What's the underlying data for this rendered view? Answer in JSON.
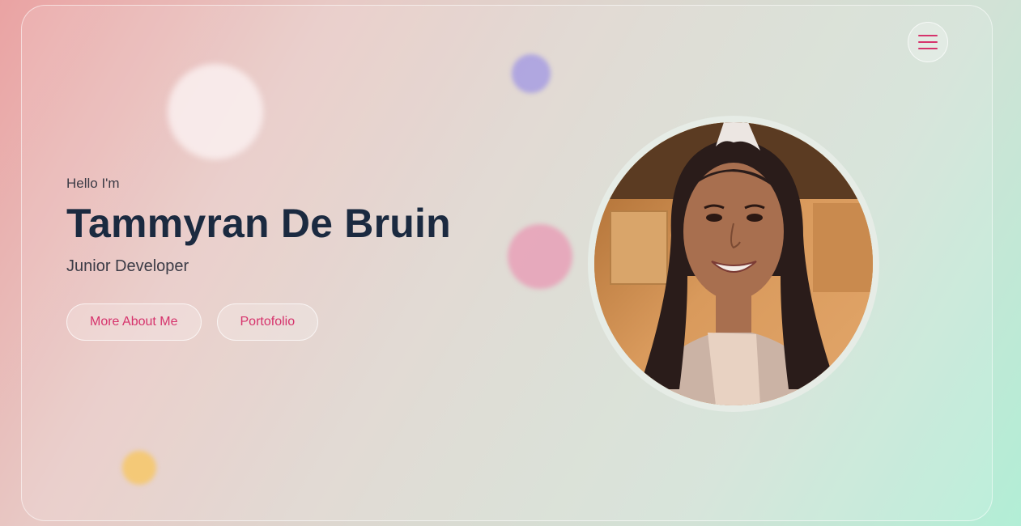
{
  "header": {
    "menu_icon": "hamburger-menu-icon"
  },
  "hero": {
    "greeting": "Hello I'm",
    "name": "Tammyran De Bruin",
    "role": "Junior Developer",
    "buttons": [
      {
        "label": "More About Me"
      },
      {
        "label": "Portofolio"
      }
    ]
  },
  "profile": {
    "image": "profile-photo"
  },
  "colors": {
    "accent": "#d6336c",
    "heading": "#1b2a40",
    "text": "#3b3b46"
  }
}
